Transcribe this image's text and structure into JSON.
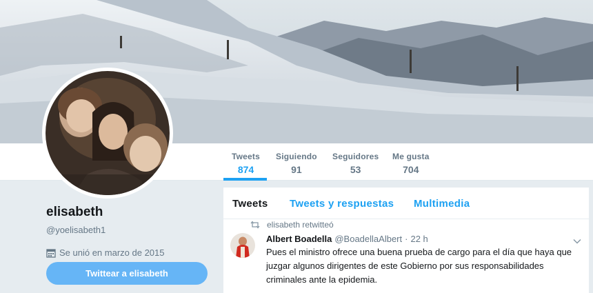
{
  "profile": {
    "name": "elisabeth",
    "handle": "@yoelisabeth1",
    "joined": "Se unió en marzo de 2015",
    "tweet_button": "Twittear a elisabeth"
  },
  "stats": [
    {
      "label": "Tweets",
      "value": "874",
      "active": true
    },
    {
      "label": "Siguiendo",
      "value": "91",
      "active": false
    },
    {
      "label": "Seguidores",
      "value": "53",
      "active": false
    },
    {
      "label": "Me gusta",
      "value": "704",
      "active": false
    }
  ],
  "timeline": {
    "tabs": [
      "Tweets",
      "Tweets y respuestas",
      "Multimedia"
    ],
    "active_tab": "Tweets"
  },
  "tweet": {
    "retweet_context": "elisabeth retwitteó",
    "author_name": "Albert Boadella",
    "author_handle": "@BoadellaAlbert",
    "separator": "·",
    "time": "22 h",
    "text": "Pues el ministro ofrece una buena prueba de cargo para el día que haya que juzgar algunos dirigentes de este Gobierno por sus responsabilidades criminales ante la epidemia."
  },
  "icons": {
    "calendar": "calendar-icon",
    "retweet": "retweet-icon",
    "caret": "chevron-down-icon"
  },
  "colors": {
    "accent": "#1da1f2",
    "button": "#66b5f6",
    "muted": "#657786",
    "background": "#e6ecf0"
  }
}
